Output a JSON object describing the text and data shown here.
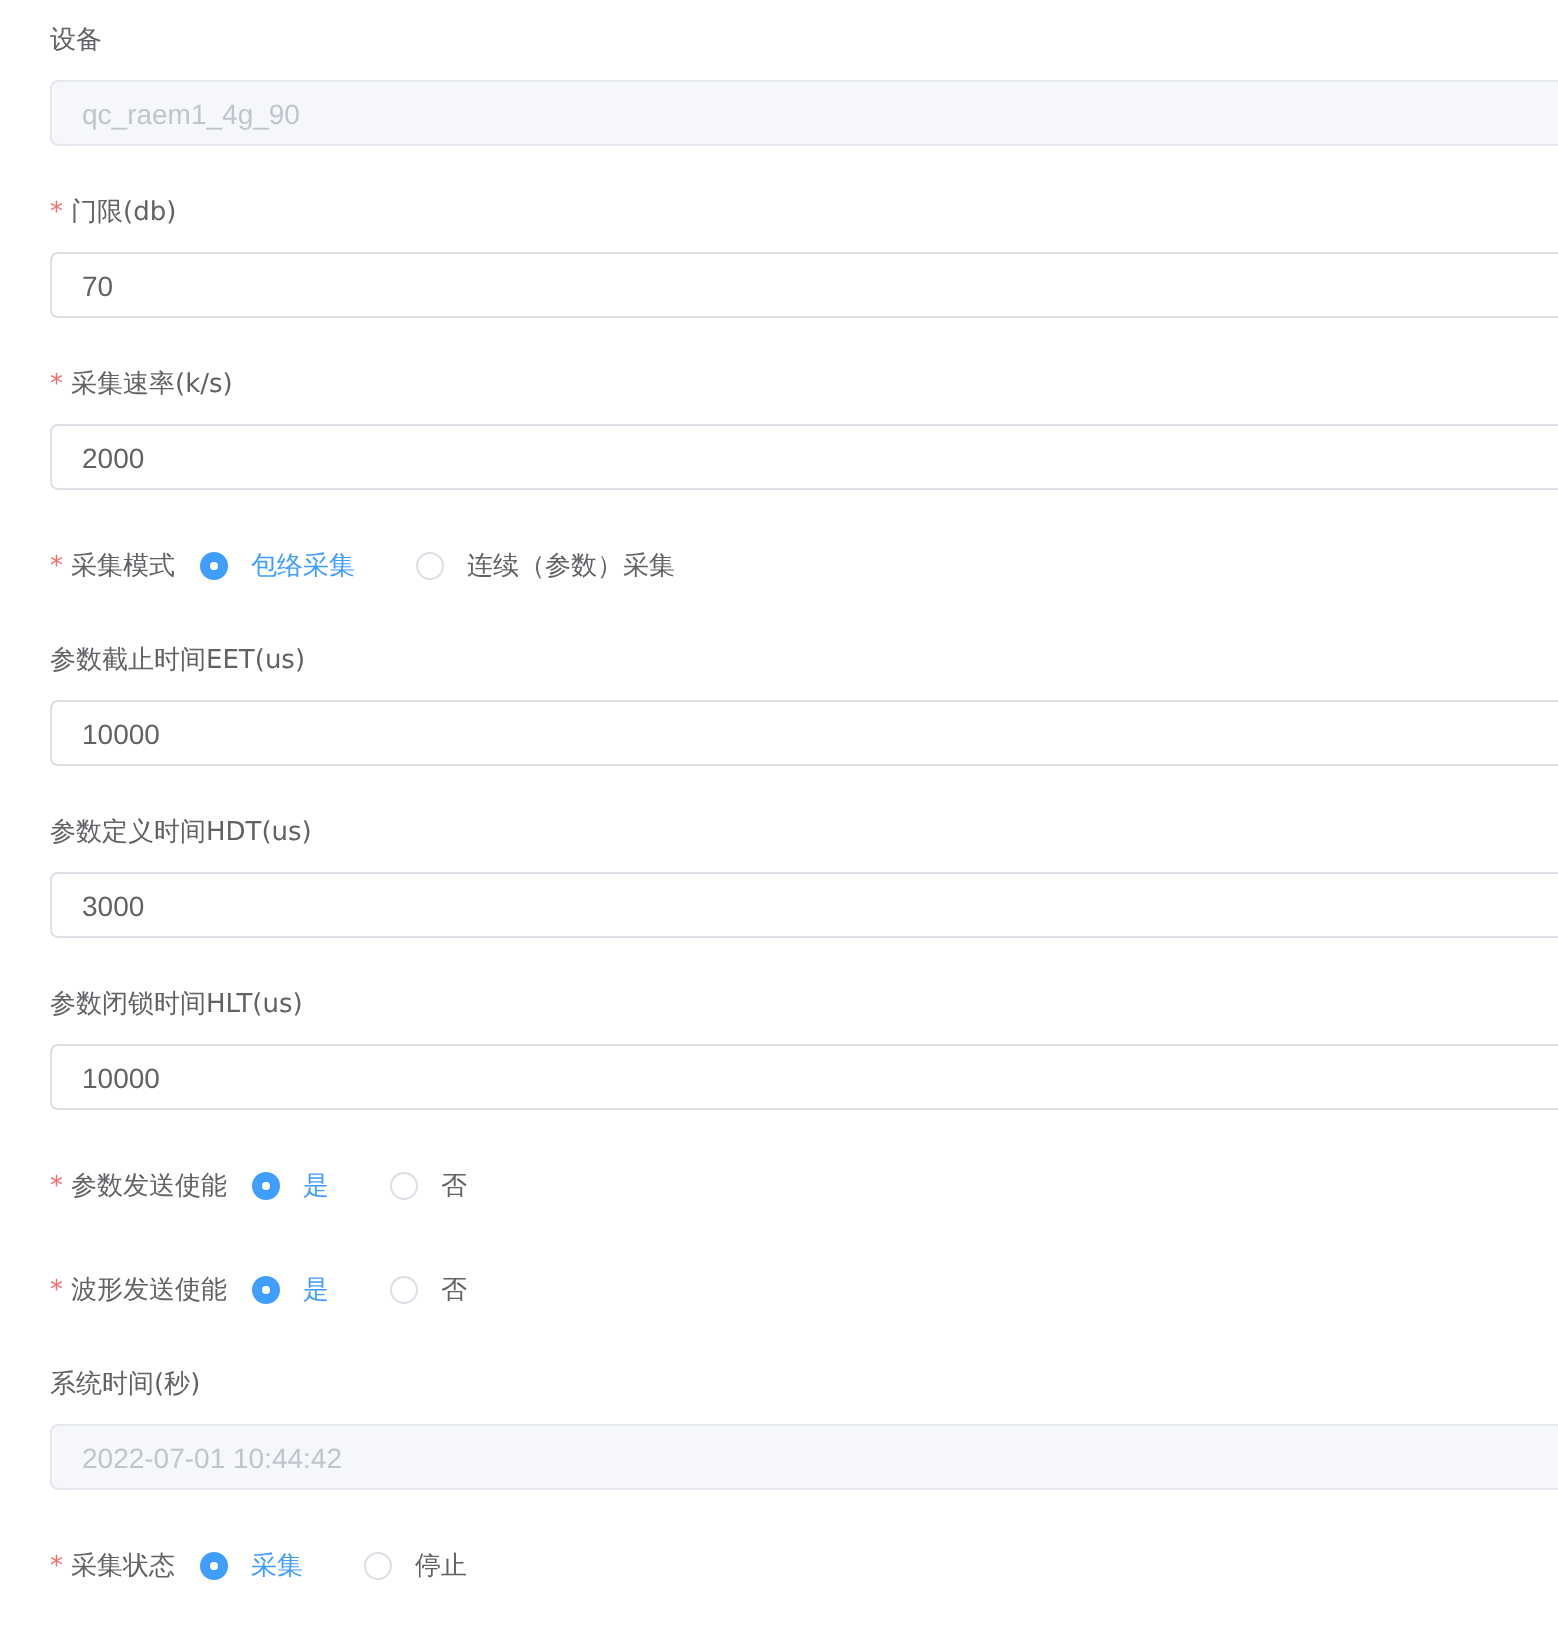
{
  "fields": [
    {
      "kind": "input",
      "label": "设备",
      "value": "qc_raem1_4g_90",
      "disabled": true
    },
    {
      "kind": "input",
      "required_mark": "*",
      "label": "门限(db)",
      "value": "70",
      "disabled": false
    },
    {
      "kind": "input",
      "required_mark": "*",
      "label": "采集速率(k/s)",
      "value": "2000",
      "disabled": false
    },
    {
      "kind": "radio",
      "required_mark": "*",
      "label": "采集模式",
      "options": [
        {
          "label": "包络采集",
          "selected": true
        },
        {
          "label": "连续（参数）采集",
          "selected": false
        }
      ]
    },
    {
      "kind": "input",
      "label": "参数截止时间EET(us)",
      "value": "10000",
      "disabled": false
    },
    {
      "kind": "input",
      "label": "参数定义时间HDT(us)",
      "value": "3000",
      "disabled": false
    },
    {
      "kind": "input",
      "label": "参数闭锁时间HLT(us)",
      "value": "10000",
      "disabled": false
    },
    {
      "kind": "radio",
      "required_mark": "*",
      "label": "参数发送使能",
      "options": [
        {
          "label": "是",
          "selected": true
        },
        {
          "label": "否",
          "selected": false
        }
      ]
    },
    {
      "kind": "radio",
      "required_mark": "*",
      "label": "波形发送使能",
      "options": [
        {
          "label": "是",
          "selected": true
        },
        {
          "label": "否",
          "selected": false
        }
      ]
    },
    {
      "kind": "input",
      "label": "系统时间(秒)",
      "value": "2022-07-01 10:44:42",
      "disabled": true
    },
    {
      "kind": "radio",
      "required_mark": "*",
      "label": "采集状态",
      "options": [
        {
          "label": "采集",
          "selected": true
        },
        {
          "label": "停止",
          "selected": false
        }
      ]
    }
  ]
}
